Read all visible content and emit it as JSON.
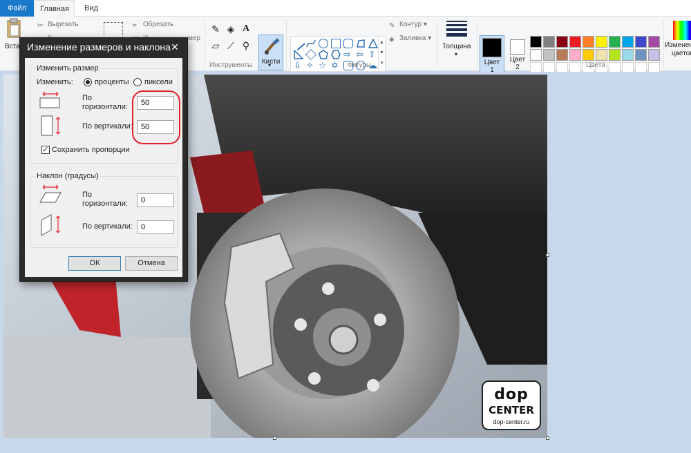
{
  "tabs": {
    "file": "Файл",
    "home": "Главная",
    "view": "Вид"
  },
  "clipboard": {
    "paste": "Вста",
    "cut": "Вырезать",
    "copy": "К"
  },
  "image": {
    "crop": "Обрезать",
    "resize": "И",
    "resize_tail": "мер"
  },
  "tools": {
    "label": "Инструменты",
    "brush": "Кисти"
  },
  "shapes": {
    "label": "Фигуры",
    "outline": "Контур",
    "fill": "Заливка"
  },
  "thickness": {
    "label": "Толщина"
  },
  "colors": {
    "label": "Цвета",
    "color1": "Цвет 1",
    "color1_a": "Цвет",
    "color1_b": "1",
    "color2_a": "Цвет",
    "color2_b": "2",
    "edit": "Изменение цветов",
    "edit_a": "Изменение",
    "edit_b": "цветов",
    "row1": [
      "#000000",
      "#7f7f7f",
      "#880015",
      "#ed1c24",
      "#ff7f27",
      "#fff200",
      "#22b14c",
      "#00a2e8",
      "#3f48cc",
      "#a349a4"
    ],
    "row2": [
      "#ffffff",
      "#c3c3c3",
      "#b97a57",
      "#ffaec9",
      "#ffc90e",
      "#efe4b0",
      "#b5e61d",
      "#99d9ea",
      "#7092be",
      "#c8bfe7"
    ]
  },
  "dialog": {
    "title": "Изменение размеров и наклона",
    "close": "✕",
    "resize_group": "Изменить размер",
    "by": "Изменить:",
    "percent": "проценты",
    "pixels": "пиксели",
    "horizontal_a": "По",
    "horizontal_b": "горизонтали:",
    "vertical": "По вертикали:",
    "h_value": "50",
    "v_value": "50",
    "keep_ratio": "Сохранить пропорции",
    "skew_group": "Наклон (градусы)",
    "skew_h_value": "0",
    "skew_v_value": "0",
    "ok": "ОК",
    "cancel": "Отмена"
  },
  "logo": {
    "line1": "dop",
    "line2": "CENTER",
    "url": "dop-center.ru"
  }
}
